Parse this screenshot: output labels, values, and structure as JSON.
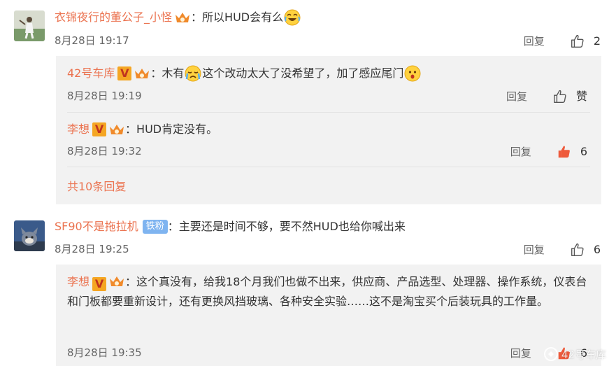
{
  "comments": [
    {
      "user": "衣锦夜行的董公子_小怪",
      "text_before": "所以HUD会有么",
      "time": "8月28日 19:17",
      "reply_label": "回复",
      "likes": "2",
      "avatar_icon": "baseball-player-avatar"
    },
    {
      "user": "SF90不是拖拉机",
      "fan_badge": "铁粉",
      "text": "主要还是时间不够，要不然HUD也给你喊出来",
      "time": "8月28日 19:25",
      "reply_label": "回复",
      "likes": "6",
      "avatar_icon": "cartoon-cat-avatar"
    }
  ],
  "replies_1": [
    {
      "user": "42号车库",
      "text_a": "木有",
      "text_b": "这个改动太大了没希望了，加了感应尾门",
      "time": "8月28日 19:19",
      "reply_label": "回复",
      "like_label": "赞"
    },
    {
      "user": "李想",
      "text": "HUD肯定没有。",
      "time": "8月28日 19:32",
      "reply_label": "回复",
      "likes": "6"
    }
  ],
  "more_replies": "共10条回复",
  "replies_2": [
    {
      "user": "李想",
      "text": "这个真没有，给我18个月我们也做不出来，供应商、产品选型、处理器、操作系统，仪表台和门板都要重新设计，还有更换风挡玻璃、各种安全实验……这不是淘宝买个后装玩具的工作量。",
      "time": "8月28日 19:35",
      "reply_label": "回复",
      "likes": "6"
    }
  ],
  "watermark": "42号车库",
  "colors": {
    "username": "#eb7350",
    "text": "#333333",
    "meta": "#666666",
    "subbox": "#f2f2f2",
    "like_active": "#ee5a3b"
  }
}
